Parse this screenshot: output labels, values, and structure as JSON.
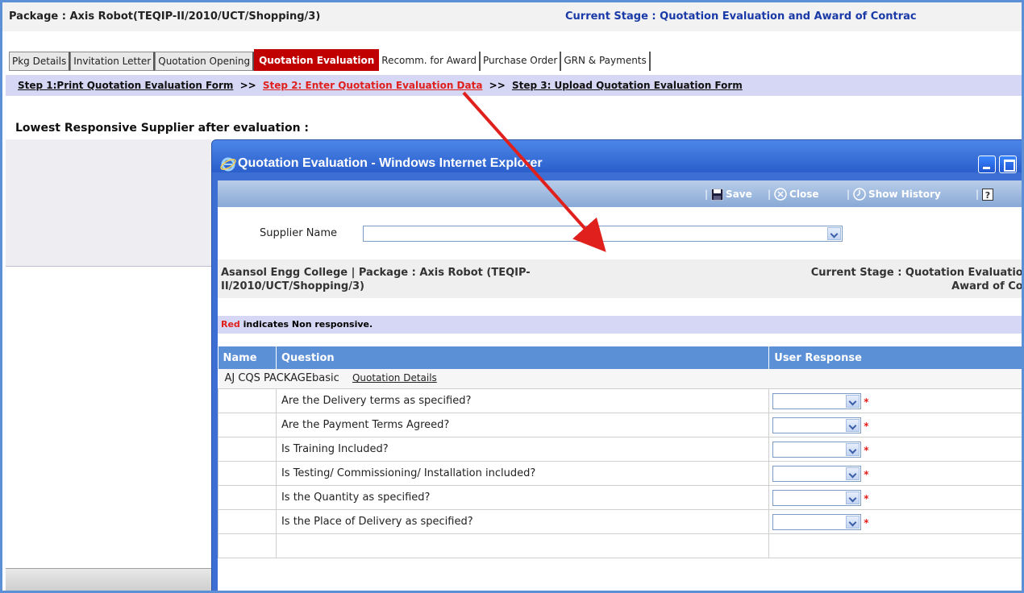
{
  "header": {
    "package_title": "Package : Axis Robot(TEQIP-II/2010/UCT/Shopping/3)",
    "current_stage": "Current Stage : Quotation Evaluation and Award of Contrac"
  },
  "tabs": [
    {
      "label": "Pkg Details"
    },
    {
      "label": "Invitation Letter"
    },
    {
      "label": "Quotation Opening"
    },
    {
      "label": "Quotation Evaluation"
    },
    {
      "label": "Recomm. for Award"
    },
    {
      "label": "Purchase Order"
    },
    {
      "label": "GRN & Payments"
    }
  ],
  "steps": {
    "step1": "Step 1:Print Quotation Evaluation Form",
    "sep": ">>",
    "step2": "Step 2: Enter Quotation Evaluation Data",
    "step3": "Step 3: Upload Quotation Evaluation Form"
  },
  "lowest_label": "Lowest Responsive Supplier after evaluation :",
  "popup": {
    "title": "Quotation Evaluation - Windows Internet Explorer",
    "toolbar": {
      "save": "Save",
      "close": "Close",
      "show_history": "Show History"
    },
    "supplier_label": "Supplier Name",
    "supplier_value": "",
    "context_left": "Asansol Engg College | Package : Axis Robot (TEQIP-II/2010/UCT/Shopping/3)",
    "context_right_line1": "Current Stage : Quotation Evaluation",
    "context_right_line2": "Award of Con",
    "note_red": "Red",
    "note_rest": " indicates Non responsive.",
    "columns": {
      "name": "Name",
      "question": "Question",
      "response": "User Response"
    },
    "group": {
      "name": "AJ CQS PACKAGEbasic",
      "link": "Quotation Details"
    },
    "questions": [
      "Are the Delivery terms as specified?",
      "Are the Payment Terms Agreed?",
      "Is Training Included?",
      "Is Testing/ Commissioning/ Installation included?",
      "Is the Quantity as specified?",
      "Is the Place of Delivery as specified?"
    ],
    "required_mark": "*"
  },
  "colors": {
    "active_tab": "#c00000",
    "accent_blue": "#5b8fd6",
    "annotation_arrow": "#e0201c"
  }
}
